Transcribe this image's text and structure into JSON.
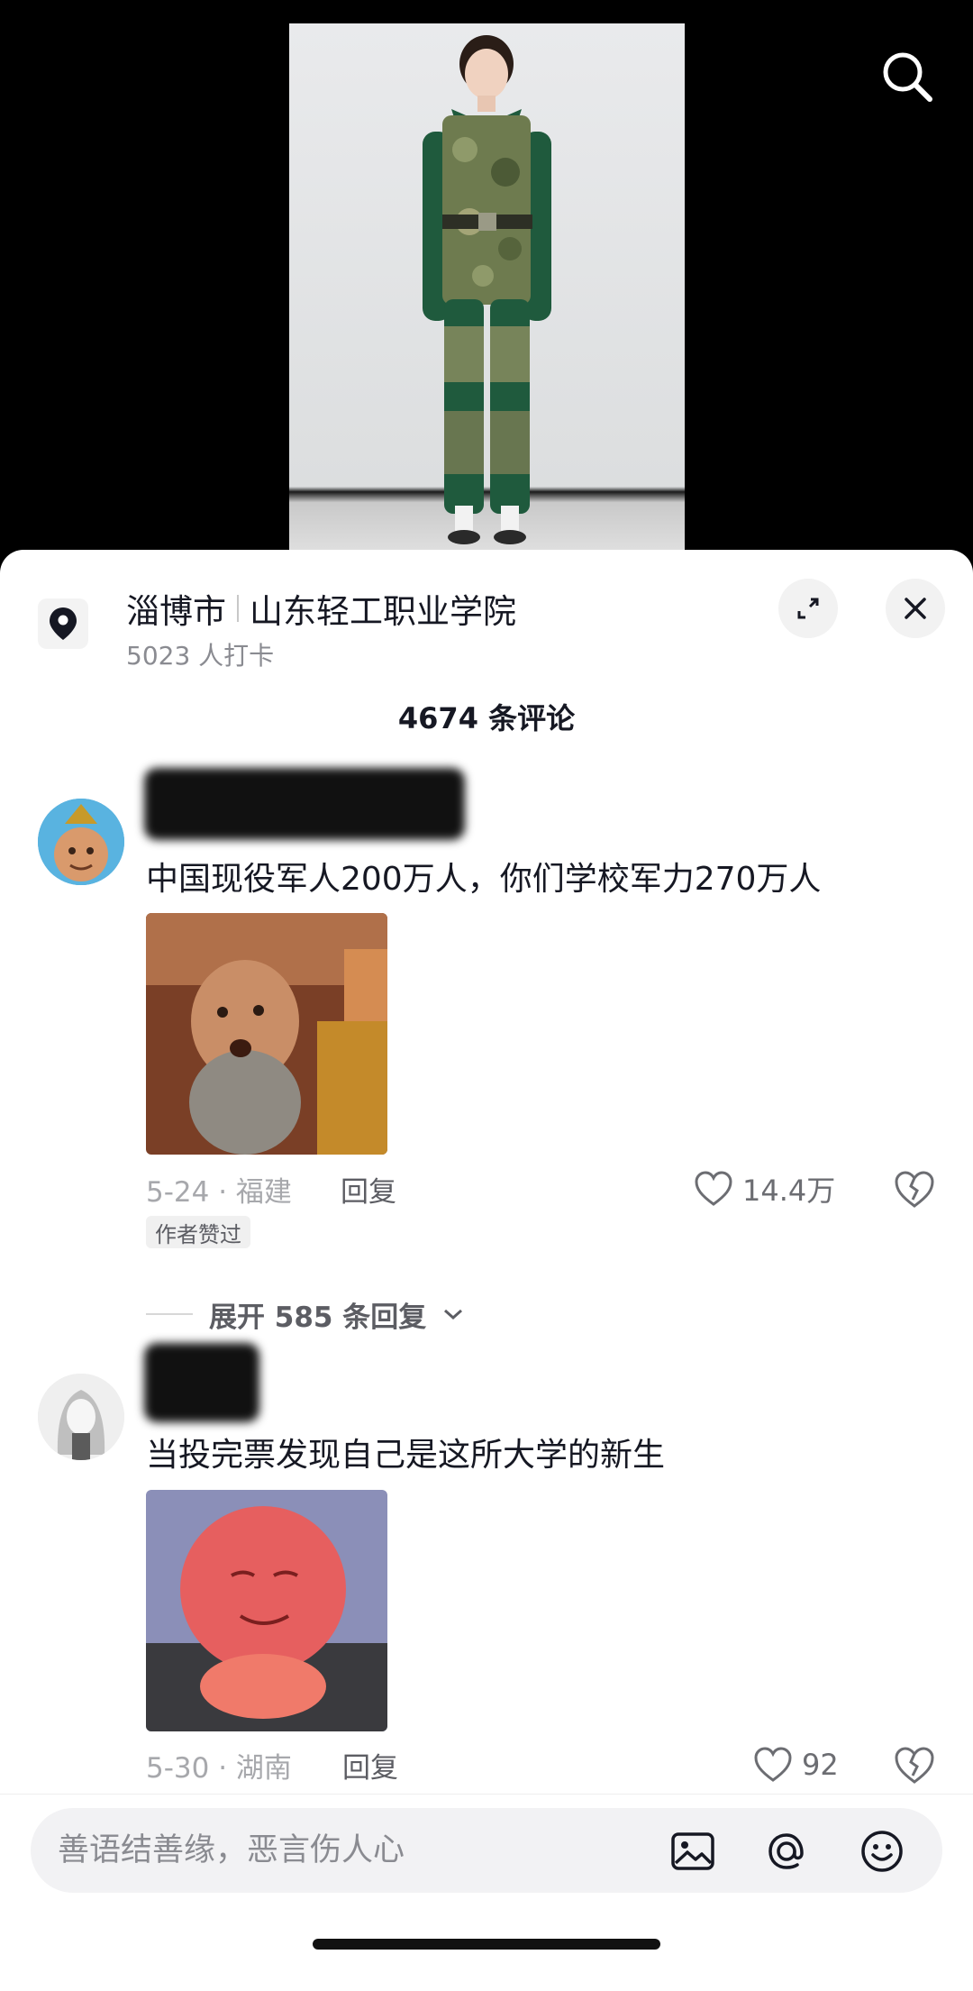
{
  "location": {
    "city": "淄博市",
    "place": "山东轻工职业学院",
    "checkins": "5023 人打卡"
  },
  "comments_header": {
    "count_label": "4674 条评论"
  },
  "comments": [
    {
      "text": "中国现役军人200万人，你们学校军力270万人",
      "date_region": "5-24 · 福建",
      "reply_label": "回复",
      "likes": "14.4万",
      "badge": "作者赞过",
      "expand_label": "展开 585 条回复"
    },
    {
      "text": "当投完票发现自己是这所大学的新生",
      "date_region": "5-30 · 湖南",
      "reply_label": "回复",
      "likes": "92"
    }
  ],
  "input": {
    "placeholder": "善语结善缘，恶言伤人心"
  },
  "icons": {
    "search": "search-icon",
    "location": "location-pin-icon",
    "expand": "expand-icon",
    "close": "close-icon",
    "like": "heart-icon",
    "dislike": "broken-heart-icon",
    "image": "image-icon",
    "mention": "at-icon",
    "emoji": "emoji-icon"
  }
}
